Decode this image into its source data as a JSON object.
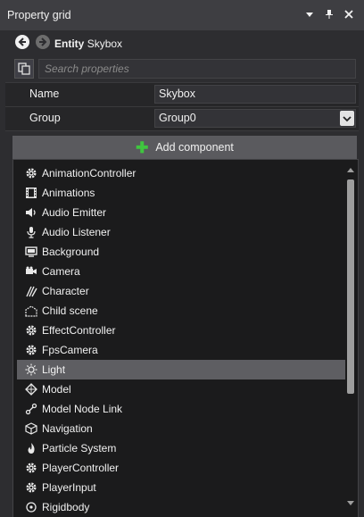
{
  "window": {
    "title": "Property grid",
    "buttons": [
      {
        "name": "dropdown-menu-icon"
      },
      {
        "name": "pin-icon"
      },
      {
        "name": "close-icon"
      }
    ]
  },
  "nav": {
    "entity_type": "Entity",
    "entity_name": "Skybox"
  },
  "search": {
    "placeholder": "Search properties",
    "value": ""
  },
  "properties": [
    {
      "label": "Name",
      "value": "Skybox"
    },
    {
      "label": "Group",
      "value": "Group0"
    }
  ],
  "add_component": {
    "label": "Add component"
  },
  "components": [
    {
      "label": "AnimationController",
      "icon": "gear-icon"
    },
    {
      "label": "Animations",
      "icon": "film-icon"
    },
    {
      "label": "Audio Emitter",
      "icon": "speaker-icon"
    },
    {
      "label": "Audio Listener",
      "icon": "microphone-icon"
    },
    {
      "label": "Background",
      "icon": "monitor-icon"
    },
    {
      "label": "Camera",
      "icon": "camera-icon"
    },
    {
      "label": "Character",
      "icon": "character-icon"
    },
    {
      "label": "Child scene",
      "icon": "child-scene-icon"
    },
    {
      "label": "EffectController",
      "icon": "gear-icon"
    },
    {
      "label": "FpsCamera",
      "icon": "gear-icon"
    },
    {
      "label": "Light",
      "icon": "light-icon",
      "selected": true
    },
    {
      "label": "Model",
      "icon": "model-icon"
    },
    {
      "label": "Model Node Link",
      "icon": "link-icon"
    },
    {
      "label": "Navigation",
      "icon": "cube-icon"
    },
    {
      "label": "Particle System",
      "icon": "flame-icon"
    },
    {
      "label": "PlayerController",
      "icon": "gear-icon"
    },
    {
      "label": "PlayerInput",
      "icon": "gear-icon"
    },
    {
      "label": "Rigidbody",
      "icon": "rigidbody-icon"
    }
  ],
  "colors": {
    "panel_bg": "#2d2d30",
    "title_bg": "#3e3e42",
    "list_bg": "#1b1b1c",
    "selected_bg": "#5e5e62",
    "add_green": "#3fc63f"
  }
}
